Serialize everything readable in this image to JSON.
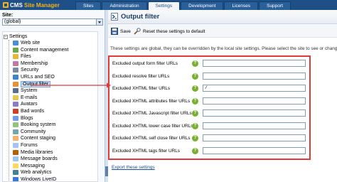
{
  "app": {
    "logo_text": "CMS",
    "logo_accent": "Site Manager"
  },
  "tabs": [
    {
      "label": "Sites",
      "active": false
    },
    {
      "label": "Administration",
      "active": false
    },
    {
      "label": "Settings",
      "active": true
    },
    {
      "label": "Development",
      "active": false
    },
    {
      "label": "Licenses",
      "active": false
    },
    {
      "label": "Support",
      "active": false
    }
  ],
  "sidebar": {
    "site_label": "Site:",
    "site_value": "(global)",
    "tree_root": "Settings",
    "items": [
      {
        "label": "Web site",
        "icon": "web-site-icon",
        "color": "#4a8fd6"
      },
      {
        "label": "Content management",
        "icon": "content-management-icon",
        "color": "#6aa84f"
      },
      {
        "label": "Files",
        "icon": "files-icon",
        "color": "#e5b83a"
      },
      {
        "label": "Membership",
        "icon": "membership-icon",
        "color": "#c27ba0"
      },
      {
        "label": "Security",
        "icon": "security-icon",
        "color": "#7f8c9d"
      },
      {
        "label": "URLs and SEO",
        "icon": "urls-seo-icon",
        "color": "#3d85c6"
      },
      {
        "label": "Output filter",
        "icon": "output-filter-icon",
        "color": "#e69138",
        "selected": true
      },
      {
        "label": "System",
        "icon": "system-icon",
        "color": "#5b6f8a"
      },
      {
        "label": "E-mails",
        "icon": "emails-icon",
        "color": "#e6c850"
      },
      {
        "label": "Avatars",
        "icon": "avatars-icon",
        "color": "#8e7cc3"
      },
      {
        "label": "Bad words",
        "icon": "bad-words-icon",
        "color": "#cc4125"
      },
      {
        "label": "Blogs",
        "icon": "blogs-icon",
        "color": "#6d9eeb"
      },
      {
        "label": "Booking system",
        "icon": "booking-system-icon",
        "color": "#93c47d"
      },
      {
        "label": "Community",
        "icon": "community-icon",
        "color": "#76a5af"
      },
      {
        "label": "Content staging",
        "icon": "content-staging-icon",
        "color": "#f6b26b"
      },
      {
        "label": "Forums",
        "icon": "forums-icon",
        "color": "#a4c2f4"
      },
      {
        "label": "Media libraries",
        "icon": "media-libraries-icon",
        "color": "#b45f06"
      },
      {
        "label": "Message boards",
        "icon": "message-boards-icon",
        "color": "#9fc5e8"
      },
      {
        "label": "Messaging",
        "icon": "messaging-icon",
        "color": "#ffd966"
      },
      {
        "label": "Web analytics",
        "icon": "web-analytics-icon",
        "color": "#45818e"
      },
      {
        "label": "Windows LiveID",
        "icon": "windows-liveid-icon",
        "color": "#3c78d8"
      }
    ]
  },
  "content": {
    "title": "Output filter",
    "save_label": "Save",
    "reset_label": "Reset these settings to default",
    "info": "These settings are global, they can be overridden by the local site settings. Please select the site to see or change the",
    "rows": [
      {
        "label": "Excluded output form filter URLs",
        "value": ""
      },
      {
        "label": "Excluded resolve filter URLs",
        "value": ""
      },
      {
        "label": "Excluded XHTML filter URLs",
        "value": "/"
      },
      {
        "label": "Excluded XHTML attributes filter URLs",
        "value": ""
      },
      {
        "label": "Excluded XHTML Javascript filter URLs",
        "value": ""
      },
      {
        "label": "Excluded XHTML lower case filter URLs",
        "value": ""
      },
      {
        "label": "Excluded XHTML self close filter URLs",
        "value": ""
      },
      {
        "label": "Excluded XHTML tags filter URLs",
        "value": ""
      }
    ],
    "help_glyph": "?",
    "export_label": "Export these settings"
  },
  "colors": {
    "header": "#1e4f86",
    "highlight_box": "#e03a3a",
    "help": "#79b030"
  }
}
